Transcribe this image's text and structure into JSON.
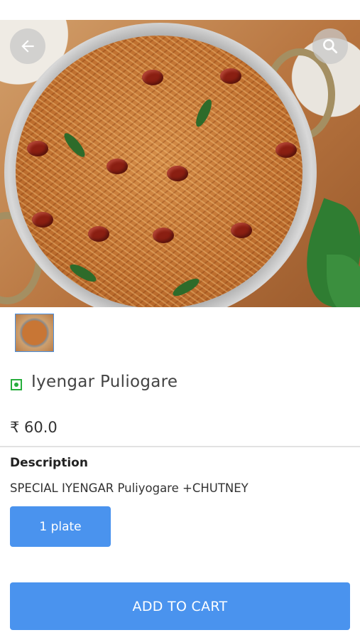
{
  "product": {
    "name": "Iyengar Puliogare",
    "price": "₹ 60.0",
    "veg_indicator_color": "#27ae3c"
  },
  "description": {
    "title": "Description",
    "text": "SPECIAL IYENGAR Puliyogare +CHUTNEY"
  },
  "variant": {
    "label": "1 plate"
  },
  "actions": {
    "add_to_cart_label": "ADD TO CART",
    "back_icon": "arrow-left-icon",
    "search_icon": "search-icon"
  },
  "theme": {
    "accent": "#4a93ee"
  }
}
